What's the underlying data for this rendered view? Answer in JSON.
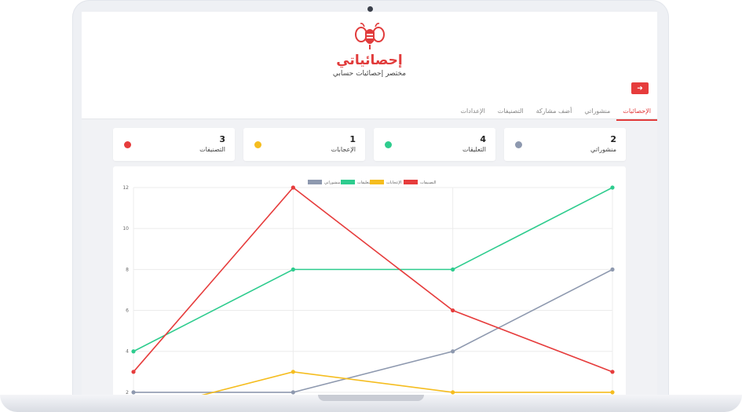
{
  "app": {
    "title": "إحصائياتي",
    "subtitle": "مختصر إحصائيات حسابي",
    "logout_icon": "➜"
  },
  "tabs": [
    {
      "label": "الإحصائيات",
      "active": true
    },
    {
      "label": "منشوراتي",
      "active": false
    },
    {
      "label": "أضف مشاركة",
      "active": false
    },
    {
      "label": "التصنيفات",
      "active": false
    },
    {
      "label": "الإعدادات",
      "active": false
    }
  ],
  "cards": [
    {
      "value": "2",
      "label": "منشوراتي",
      "color": "#8e99af"
    },
    {
      "value": "4",
      "label": "التعليقات",
      "color": "#2ecc8e"
    },
    {
      "value": "1",
      "label": "الإعجابات",
      "color": "#f5bd1f"
    },
    {
      "value": "3",
      "label": "التصنيفات",
      "color": "#e63c3c"
    }
  ],
  "chart_data": {
    "type": "line",
    "x": [
      0,
      1,
      2,
      3
    ],
    "ylim": [
      1,
      12
    ],
    "yticks": [
      2,
      4,
      6,
      8,
      10,
      12
    ],
    "grid": true,
    "legend": "top-center",
    "series": [
      {
        "name": "منشوراتي",
        "color": "#8e99af",
        "values": [
          2,
          2,
          4,
          8
        ]
      },
      {
        "name": "التعليقات",
        "color": "#2ecc8e",
        "values": [
          4,
          8,
          8,
          12
        ]
      },
      {
        "name": "الإعجابات",
        "color": "#f5bd1f",
        "values": [
          1,
          3,
          2,
          2
        ]
      },
      {
        "name": "التصنيفات",
        "color": "#e63c3c",
        "values": [
          3,
          12,
          6,
          3
        ]
      }
    ]
  }
}
